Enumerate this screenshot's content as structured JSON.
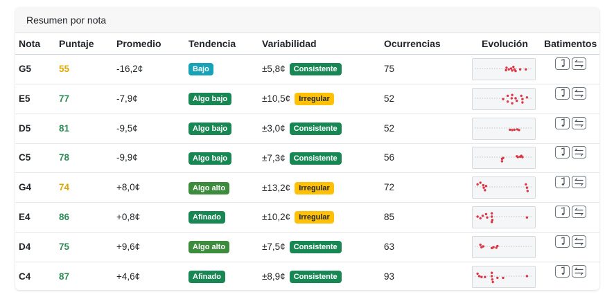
{
  "card": {
    "title": "Resumen por nota"
  },
  "columns": {
    "note": "Nota",
    "score": "Puntaje",
    "average": "Promedio",
    "trend": "Tendencia",
    "variability": "Variabilidad",
    "occurrences": "Ocurrencias",
    "evolution": "Evolución",
    "beats": "Batimentos"
  },
  "colors": {
    "score_good": "#2e8b57",
    "score_warn": "#e0a800",
    "bajo": "#17a2b8",
    "algo_bajo": "#198754",
    "algo_alto": "#3d8b3d",
    "afinado": "#198754",
    "consistente": "#198754",
    "irregular": "#ffc107",
    "sparkline_point": "#dc3545"
  },
  "icons": {
    "play": "music-note-icon",
    "beats": "arrows-exchange-icon"
  },
  "rows": [
    {
      "note": "G5",
      "score": "55",
      "score_level": "warn",
      "average": "-16,2¢",
      "trend": "Bajo",
      "trend_kind": "bajo",
      "variability": "±5,8¢",
      "var_label": "Consistente",
      "var_kind": "consistente",
      "occurrences": "75",
      "evolution": [
        [
          0.55,
          0.6
        ],
        [
          0.56,
          0.45
        ],
        [
          0.6,
          0.55
        ],
        [
          0.64,
          0.5
        ],
        [
          0.66,
          0.62
        ],
        [
          0.68,
          0.4
        ],
        [
          0.7,
          0.55
        ],
        [
          0.72,
          0.65
        ],
        [
          0.8,
          0.55
        ],
        [
          0.9,
          0.55
        ]
      ]
    },
    {
      "note": "E5",
      "score": "77",
      "score_level": "good",
      "average": "-7,9¢",
      "trend": "Algo bajo",
      "trend_kind": "algo_bajo",
      "variability": "±10,5¢",
      "var_label": "Irregular",
      "var_kind": "irregular",
      "occurrences": "52",
      "evolution": [
        [
          0.5,
          0.55
        ],
        [
          0.58,
          0.35
        ],
        [
          0.58,
          0.7
        ],
        [
          0.65,
          0.5
        ],
        [
          0.66,
          0.3
        ],
        [
          0.66,
          0.8
        ],
        [
          0.72,
          0.5
        ],
        [
          0.74,
          0.65
        ],
        [
          0.82,
          0.35
        ],
        [
          0.84,
          0.55
        ],
        [
          0.84,
          0.75
        ],
        [
          0.92,
          0.45
        ]
      ]
    },
    {
      "note": "D5",
      "score": "81",
      "score_level": "good",
      "average": "-9,5¢",
      "trend": "Algo bajo",
      "trend_kind": "algo_bajo",
      "variability": "±3,0¢",
      "var_label": "Consistente",
      "var_kind": "consistente",
      "occurrences": "52",
      "evolution": [
        [
          0.62,
          0.6
        ],
        [
          0.66,
          0.62
        ],
        [
          0.7,
          0.6
        ],
        [
          0.75,
          0.58
        ],
        [
          0.78,
          0.62
        ]
      ]
    },
    {
      "note": "C5",
      "score": "78",
      "score_level": "good",
      "average": "-9,9¢",
      "trend": "Algo bajo",
      "trend_kind": "algo_bajo",
      "variability": "±7,3¢",
      "var_label": "Consistente",
      "var_kind": "consistente",
      "occurrences": "56",
      "evolution": [
        [
          0.48,
          0.6
        ],
        [
          0.48,
          0.75
        ],
        [
          0.5,
          0.55
        ],
        [
          0.74,
          0.45
        ],
        [
          0.76,
          0.5
        ],
        [
          0.8,
          0.48
        ],
        [
          0.82,
          0.42
        ],
        [
          0.84,
          0.5
        ]
      ]
    },
    {
      "note": "G4",
      "score": "74",
      "score_level": "warn",
      "average": "+8,0¢",
      "trend": "Algo alto",
      "trend_kind": "algo_alto",
      "variability": "±13,2¢",
      "var_label": "Irregular",
      "var_kind": "irregular",
      "occurrences": "72",
      "evolution": [
        [
          0.05,
          0.35
        ],
        [
          0.1,
          0.25
        ],
        [
          0.15,
          0.4
        ],
        [
          0.16,
          0.55
        ],
        [
          0.18,
          0.7
        ],
        [
          0.2,
          0.45
        ],
        [
          0.9,
          0.35
        ],
        [
          0.92,
          0.55
        ],
        [
          0.93,
          0.75
        ]
      ]
    },
    {
      "note": "E4",
      "score": "86",
      "score_level": "good",
      "average": "+0,8¢",
      "trend": "Afinado",
      "trend_kind": "afinado",
      "variability": "±10,2¢",
      "var_label": "Irregular",
      "var_kind": "irregular",
      "occurrences": "85",
      "evolution": [
        [
          0.05,
          0.5
        ],
        [
          0.1,
          0.6
        ],
        [
          0.14,
          0.45
        ],
        [
          0.2,
          0.35
        ],
        [
          0.22,
          0.55
        ],
        [
          0.3,
          0.3
        ],
        [
          0.3,
          0.5
        ],
        [
          0.31,
          0.7
        ],
        [
          0.3,
          0.82
        ],
        [
          0.92,
          0.55
        ]
      ]
    },
    {
      "note": "D4",
      "score": "75",
      "score_level": "good",
      "average": "+9,6¢",
      "trend": "Algo alto",
      "trend_kind": "algo_alto",
      "variability": "±7,5¢",
      "var_label": "Consistente",
      "var_kind": "consistente",
      "occurrences": "63",
      "evolution": [
        [
          0.1,
          0.4
        ],
        [
          0.12,
          0.55
        ],
        [
          0.15,
          0.5
        ],
        [
          0.3,
          0.6
        ],
        [
          0.33,
          0.55
        ],
        [
          0.38,
          0.58
        ],
        [
          0.4,
          0.48
        ]
      ]
    },
    {
      "note": "C4",
      "score": "87",
      "score_level": "good",
      "average": "+4,6¢",
      "trend": "Afinado",
      "trend_kind": "afinado",
      "variability": "±8,9¢",
      "var_label": "Consistente",
      "var_kind": "consistente",
      "occurrences": "93",
      "evolution": [
        [
          0.05,
          0.35
        ],
        [
          0.08,
          0.5
        ],
        [
          0.12,
          0.55
        ],
        [
          0.18,
          0.55
        ],
        [
          0.3,
          0.3
        ],
        [
          0.3,
          0.5
        ],
        [
          0.31,
          0.7
        ],
        [
          0.32,
          0.85
        ],
        [
          0.4,
          0.6
        ],
        [
          0.5,
          0.6
        ],
        [
          0.92,
          0.5
        ]
      ]
    }
  ]
}
